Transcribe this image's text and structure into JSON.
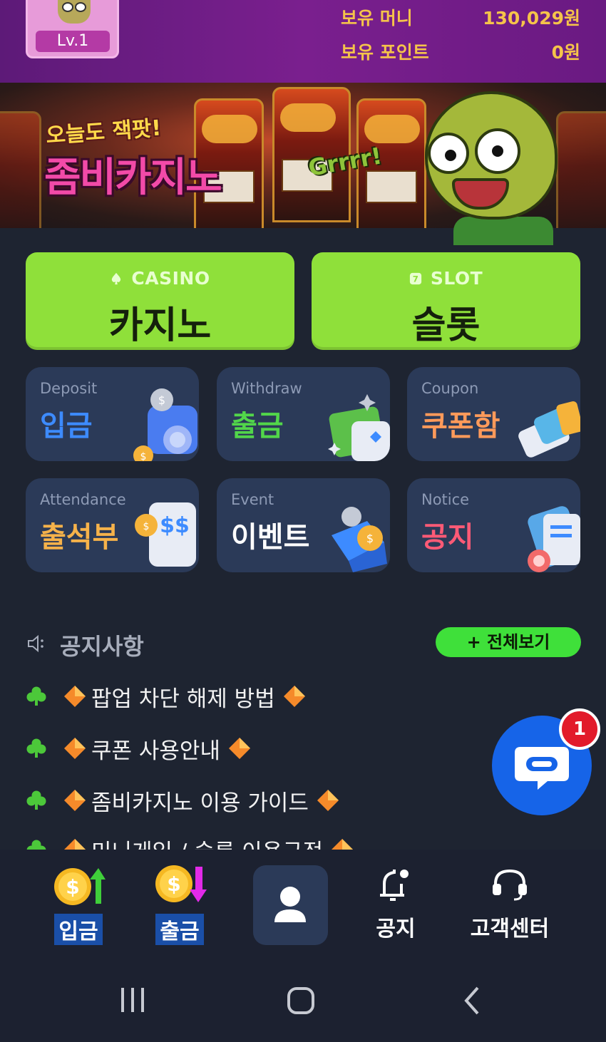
{
  "header": {
    "level": "Lv.1",
    "money_label": "보유 머니",
    "money_value": "130,029원",
    "points_label": "보유 포인트",
    "points_value": "0원"
  },
  "banner": {
    "tagline": "오늘도 잭팟!",
    "title": "좀비카지노",
    "growl": "Grrrr!"
  },
  "games": [
    {
      "sub": "CASINO",
      "label": "카지노"
    },
    {
      "sub": "SLOT",
      "label": "슬롯"
    }
  ],
  "cards": [
    {
      "en": "Deposit",
      "ko": "입금",
      "color": "#3d8bff"
    },
    {
      "en": "Withdraw",
      "ko": "출금",
      "color": "#52d64a"
    },
    {
      "en": "Coupon",
      "ko": "쿠폰함",
      "color": "#ff9a5a"
    },
    {
      "en": "Attendance",
      "ko": "출석부",
      "color": "#f6b24a"
    },
    {
      "en": "Event",
      "ko": "이벤트",
      "color": "#ffffff"
    },
    {
      "en": "Notice",
      "ko": "공지",
      "color": "#ff5a76"
    }
  ],
  "notice": {
    "title": "공지사항",
    "view_all": "+ 전체보기",
    "items": [
      "팝업 차단 해제 방법",
      "쿠폰 사용안내",
      "좀비카지노 이용 가이드",
      "미니게임 / 슬롯 이용규정"
    ]
  },
  "chat": {
    "badge": "1"
  },
  "bottom_nav": {
    "deposit": "입금",
    "withdraw": "출금",
    "notice": "공지",
    "support": "고객센터"
  }
}
